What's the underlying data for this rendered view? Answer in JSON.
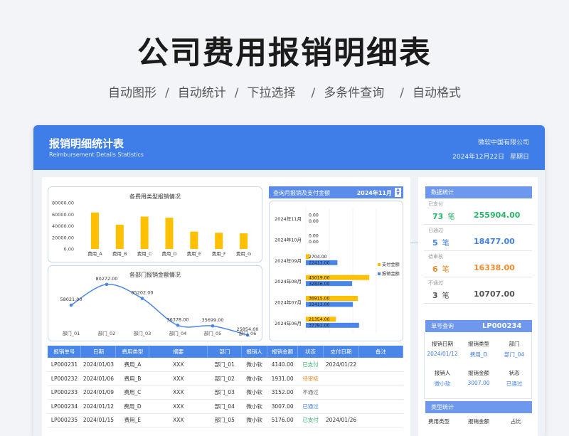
{
  "hero": {
    "title": "公司费用报销明细表",
    "features": [
      "自动图形",
      "自动统计",
      "下拉选择",
      "多条件查询",
      "自动格式"
    ],
    "separator": "/"
  },
  "banner": {
    "title": "报销明细统计表",
    "subtitle": "Reimbursement Details Statistics",
    "company": "微软中国有限公司",
    "date": "2024年12月22日",
    "weekday": "星期日"
  },
  "chart_data": [
    {
      "type": "bar",
      "title": "各费用类型报销情况",
      "categories": [
        "费用_A",
        "费用_B",
        "费用_C",
        "费用_D",
        "费用_E",
        "费用_F",
        "费用_G"
      ],
      "values": [
        63000,
        42000,
        56000,
        54000,
        30000,
        28000,
        27000
      ],
      "ylim": [
        0,
        80000
      ],
      "yticks": [
        "80000.00",
        "60000.00",
        "40000.00",
        "20000.00",
        "0.00"
      ],
      "color": "#ffc000"
    },
    {
      "type": "line",
      "title": "各部门报销金额情况",
      "categories": [
        "部门_01",
        "部门_02",
        "部门_03",
        "部门_04",
        "部门_05",
        "部门_06"
      ],
      "values": [
        58021,
        80272,
        65202,
        36378,
        35699,
        25854
      ],
      "data_labels": [
        "58021.00",
        "80272.00",
        "65202.00",
        "36378.00",
        "35699.00",
        "25854.00"
      ],
      "ylim": [
        0,
        100000
      ],
      "color": "#4a86ea"
    },
    {
      "type": "bar",
      "orientation": "horizontal",
      "title": "查询月报销及支付金额",
      "period": "2024年11月",
      "categories": [
        "2024年11月",
        "2024年10月",
        "2024年09月",
        "2024年08月",
        "2024年07月",
        "2024年06月"
      ],
      "series": [
        {
          "name": "支付金额",
          "values": [
            0,
            0,
            2704,
            45019,
            36915,
            21354
          ],
          "labels": [
            "0.00",
            "0.00",
            "2704.00",
            "45019.00",
            "36915.00",
            "21354.00"
          ],
          "color": "#ffc000"
        },
        {
          "name": "报销金额",
          "values": [
            0,
            0,
            22413,
            32846,
            33413,
            37791
          ],
          "labels": [
            "0.00",
            "0.00",
            "22413.00",
            "32846.00",
            "33413.00",
            "37791.00"
          ],
          "color": "#4a86ea"
        }
      ],
      "xlim": [
        0,
        50000
      ],
      "legend": "right"
    }
  ],
  "table": {
    "headers": [
      "报销单号",
      "日期",
      "费用类型",
      "摘要",
      "部门",
      "报销人",
      "报销金额",
      "状态",
      "支付日期",
      "备注"
    ],
    "rows": [
      [
        "LP000231",
        "2024/01/03",
        "费用_A",
        "XXX",
        "部门_01",
        "微小软",
        "4140.00",
        "已支付",
        "2024/01/22",
        ""
      ],
      [
        "LP000232",
        "2024/01/06",
        "费用_B",
        "XXX",
        "部门_02",
        "微小软",
        "1931.00",
        "待审核",
        "",
        ""
      ],
      [
        "LP000233",
        "2024/01/09",
        "费用_C",
        "XXX",
        "部门_03",
        "微小软",
        "3152.00",
        "不通过",
        "",
        ""
      ],
      [
        "LP000234",
        "2024/01/12",
        "费用_D",
        "XXX",
        "部门_04",
        "微小软",
        "3007.00",
        "已通过",
        "",
        ""
      ],
      [
        "LP000235",
        "2024/01/15",
        "费用_E",
        "XXX",
        "部门_05",
        "微小软",
        "5176.00",
        "已支付",
        "2024/01/26",
        ""
      ]
    ]
  },
  "stats": {
    "title": "数据统计",
    "unit": "笔",
    "items": [
      {
        "label": "已支付",
        "count": "73",
        "amount": "255904.00",
        "color": "#2cb46b"
      },
      {
        "label": "已通过",
        "count": "5",
        "amount": "18477.00",
        "color": "#3f7ee8"
      },
      {
        "label": "待审核",
        "count": "6",
        "amount": "16338.00",
        "color": "#f08a2a"
      },
      {
        "label": "不通过",
        "count": "3",
        "amount": "10707.00",
        "color": "#555555"
      }
    ]
  },
  "query": {
    "title": "单号查询",
    "id": "LP000234",
    "labels1": [
      "报销日期",
      "报销类型",
      "部门"
    ],
    "values1": [
      "2024/01/12",
      "费用_D",
      "部门_04"
    ],
    "labels2": [
      "报销人",
      "报销金额",
      "状态"
    ],
    "values2": [
      "微小软",
      "3007.00",
      "已通过"
    ]
  },
  "type_stats": {
    "title": "类型统计",
    "headers": [
      "费用类型",
      "报销金额",
      "占比"
    ]
  }
}
